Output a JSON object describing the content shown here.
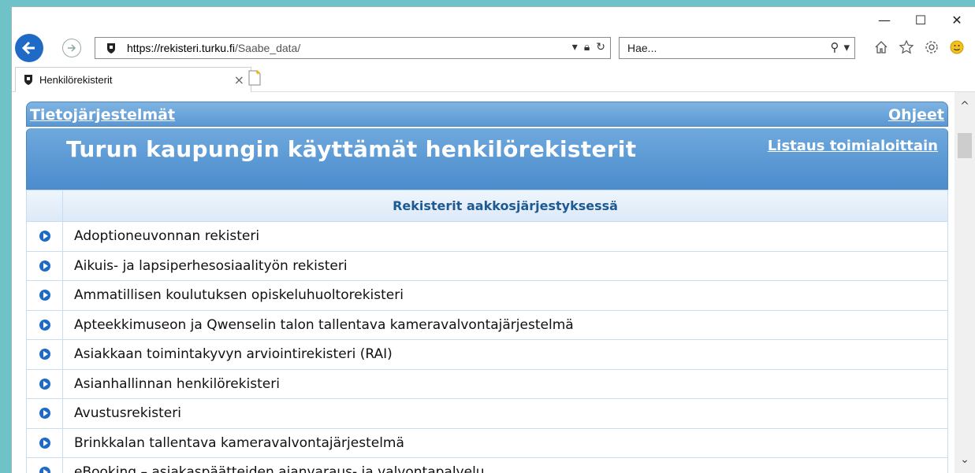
{
  "window": {
    "minimize": "—",
    "maximize": "☐",
    "close": "✕"
  },
  "address": {
    "url_prefix": "https://rekisteri.",
    "url_domain": "turku.fi",
    "url_path": "/Saabe_data/",
    "search_placeholder": "Hae..."
  },
  "tab": {
    "label": "Henkilörekisterit",
    "close": "×"
  },
  "page": {
    "nav_left": "Tietojärjestelmät",
    "nav_right": "Ohjeet",
    "title": "Turun kaupungin käyttämät henkilörekisterit",
    "listaus": "Listaus toimialoittain",
    "table_header": "Rekisterit aakkosjärjestyksessä",
    "rows": [
      "Adoptioneuvonnan rekisteri",
      "Aikuis- ja lapsiperhesosiaalityön rekisteri",
      "Ammatillisen koulutuksen opiskeluhuoltorekisteri",
      "Apteekkimuseon ja Qwenselin talon tallentava kameravalvontajärjestelmä",
      "Asiakkaan toimintakyvyn arviointirekisteri (RAI)",
      "Asianhallinnan henkilörekisteri",
      "Avustusrekisteri",
      "Brinkkalan tallentava kameravalvontajärjestelmä",
      "eBooking – asiakaspäätteiden ajanvaraus- ja valvontapalvelu"
    ]
  },
  "colors": {
    "accent": "#1f6ac6",
    "header": "#5a97d4"
  }
}
